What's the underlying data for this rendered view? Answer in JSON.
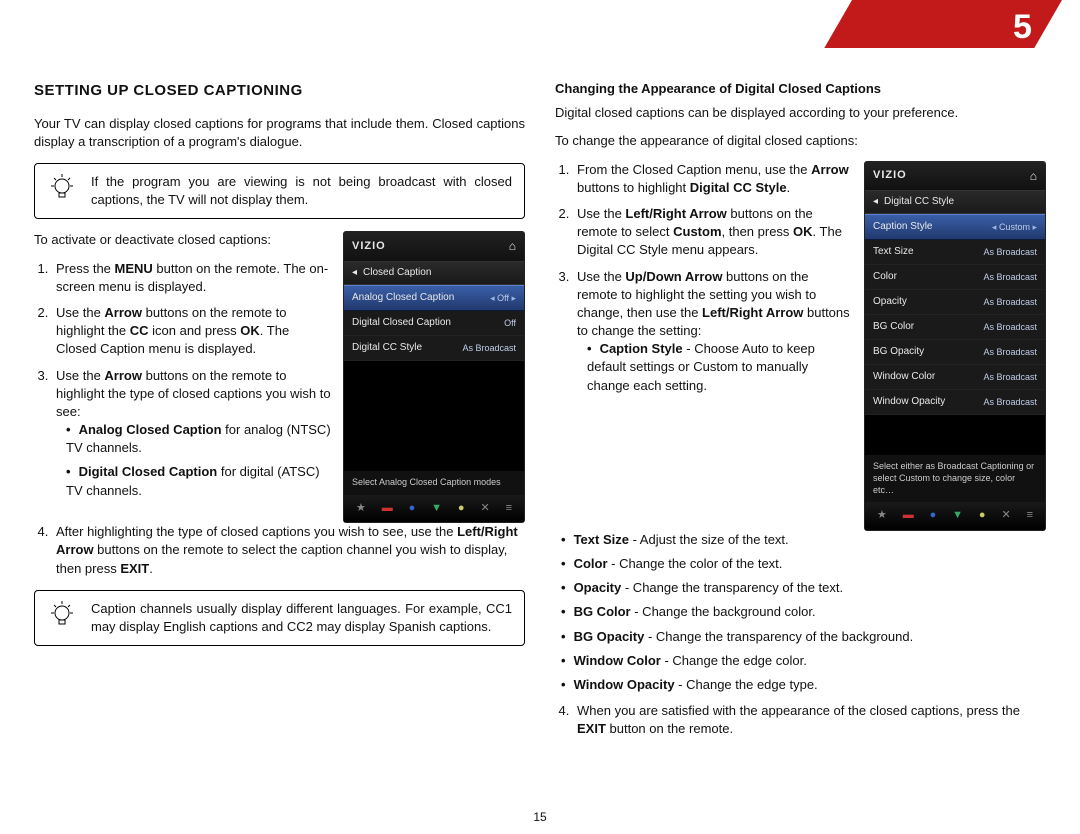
{
  "chapter_number": "5",
  "page_number": "15",
  "left": {
    "heading": "SETTING UP CLOSED CAPTIONING",
    "intro": "Your TV can display closed captions for programs that include them. Closed captions display a transcription of a program's dialogue.",
    "tip1": "If the program you are viewing is not being broadcast with closed captions, the TV will not display them.",
    "activate_lead": "To activate or deactivate closed captions:",
    "steps": {
      "s1a": "Press the ",
      "s1b": "MENU",
      "s1c": " button on the remote. The on-screen menu is displayed.",
      "s2a": "Use the ",
      "s2b": "Arrow",
      "s2c": " buttons on the remote to highlight the ",
      "s2d": "CC",
      "s2e": " icon and press ",
      "s2f": "OK",
      "s2g": ". The Closed Caption menu is displayed.",
      "s3a": "Use the ",
      "s3b": "Arrow",
      "s3c": " buttons on the remote to highlight the type of closed captions you wish to see:",
      "b1a": "Analog Closed Caption",
      "b1b": " for analog (NTSC) TV channels.",
      "b2a": "Digital Closed Caption",
      "b2b": " for digital (ATSC) TV channels.",
      "s4a": "After highlighting the type of closed captions you wish to see, use the ",
      "s4b": "Left/Right Arrow",
      "s4c": " buttons on the remote to select the caption channel you wish to display, then press ",
      "s4d": "EXIT",
      "s4e": "."
    },
    "tip2": "Caption channels usually display different languages. For example, CC1 may display English captions and CC2 may display Spanish captions.",
    "tv": {
      "logo": "VIZIO",
      "title": "Closed Caption",
      "rows": [
        {
          "label": "Analog Closed Caption",
          "value": "Off",
          "selected": true,
          "arrows": true
        },
        {
          "label": "Digital Closed Caption",
          "value": "Off"
        },
        {
          "label": "Digital CC Style",
          "value": "As Broadcast"
        }
      ],
      "hint": "Select Analog Closed Caption modes"
    }
  },
  "right": {
    "heading": "Changing the Appearance of Digital Closed Captions",
    "intro": "Digital closed captions can be displayed according to your preference.",
    "lead": "To change the appearance of digital closed captions:",
    "steps": {
      "s1a": "From the Closed Caption menu, use the ",
      "s1b": "Arrow",
      "s1c": " buttons to highlight ",
      "s1d": "Digital CC Style",
      "s1e": ".",
      "s2a": "Use the ",
      "s2b": "Left/Right Arrow",
      "s2c": " buttons on the remote to select ",
      "s2d": "Custom",
      "s2e": ", then press ",
      "s2f": "OK",
      "s2g": ". The Digital CC Style menu appears.",
      "s3a": "Use the ",
      "s3b": "Up/Down Arrow",
      "s3c": " buttons on the remote to highlight the setting you wish to change, then use the ",
      "s3d": "Left/Right Arrow",
      "s3e": " buttons to change the setting:",
      "b1a": "Caption Style",
      "b1b": " - Choose Auto to keep default settings or Custom to manually change each setting.",
      "b2a": "Text Size",
      "b2b": " - Adjust the size of the text.",
      "b3a": "Color",
      "b3b": " - Change the color of the text.",
      "b4a": "Opacity",
      "b4b": " - Change the transparency of the text.",
      "b5a": "BG Color",
      "b5b": " - Change the background color.",
      "b6a": "BG Opacity",
      "b6b": " - Change the transparency of the background.",
      "b7a": "Window Color",
      "b7b": " - Change the edge color.",
      "b8a": "Window Opacity",
      "b8b": " - Change the edge type.",
      "s4a": "When you are satisfied with the appearance of the closed captions, press the ",
      "s4b": "EXIT",
      "s4c": " button on the remote."
    },
    "tv": {
      "logo": "VIZIO",
      "title": "Digital CC Style",
      "rows": [
        {
          "label": "Caption Style",
          "value": "Custom",
          "selected": true,
          "arrows": true
        },
        {
          "label": "Text Size",
          "value": "As Broadcast"
        },
        {
          "label": "Color",
          "value": "As Broadcast"
        },
        {
          "label": "Opacity",
          "value": "As Broadcast"
        },
        {
          "label": "BG Color",
          "value": "As Broadcast"
        },
        {
          "label": "BG Opacity",
          "value": "As Broadcast"
        },
        {
          "label": "Window Color",
          "value": "As Broadcast"
        },
        {
          "label": "Window Opacity",
          "value": "As Broadcast"
        }
      ],
      "hint": "Select either as Broadcast Captioning or select Custom to change size, color etc…"
    }
  },
  "icons": {
    "home": "⌂",
    "back": "◂",
    "left_arrow": "◂",
    "right_arrow": "▸",
    "star": "★",
    "x": "✕"
  }
}
